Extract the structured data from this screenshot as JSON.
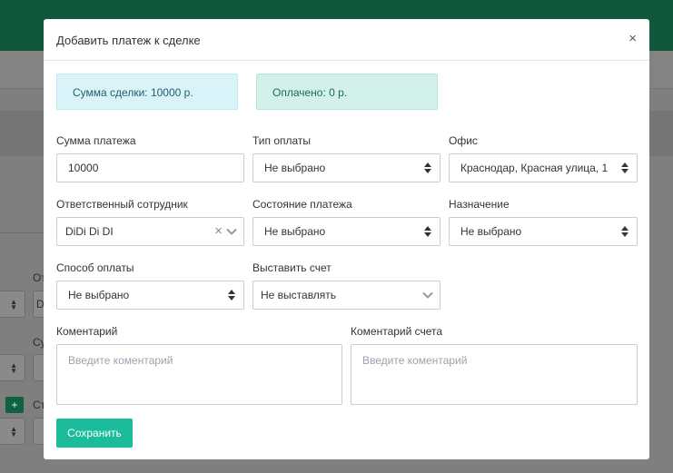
{
  "modal": {
    "title": "Добавить платеж к сделке",
    "close_symbol": "×",
    "summary": {
      "deal_amount": "Сумма сделки: 10000 р.",
      "paid": "Оплачено: 0 р."
    },
    "fields": {
      "payment_amount": {
        "label": "Сумма платежа",
        "value": "10000"
      },
      "payment_type": {
        "label": "Тип оплаты",
        "value": "Не выбрано"
      },
      "office": {
        "label": "Офис",
        "value": "Краснодар, Красная улица, 1"
      },
      "responsible": {
        "label": "Ответственный сотрудник",
        "value": "DiDi Di DI",
        "clear_symbol": "×"
      },
      "payment_status": {
        "label": "Состояние платежа",
        "value": "Не выбрано"
      },
      "purpose": {
        "label": "Назначение",
        "value": "Не выбрано"
      },
      "payment_method": {
        "label": "Способ оплаты",
        "value": "Не выбрано"
      },
      "invoice": {
        "label": "Выставить счет",
        "value": "Не выставлять"
      },
      "comment": {
        "label": "Коментарий",
        "placeholder": "Введите коментарий"
      },
      "invoice_comment": {
        "label": "Коментарий счета",
        "placeholder": "Введите коментарий"
      }
    },
    "save_label": "Сохранить"
  },
  "background": {
    "partial_labels": [
      "От",
      "Су",
      "Ст"
    ],
    "partial_value": "D",
    "plus_symbol": "+"
  },
  "colors": {
    "topbar": "#11573b",
    "save_button": "#1bbc9b",
    "info_alert": "#d9f3f9",
    "success_alert": "#d2f1ea"
  }
}
